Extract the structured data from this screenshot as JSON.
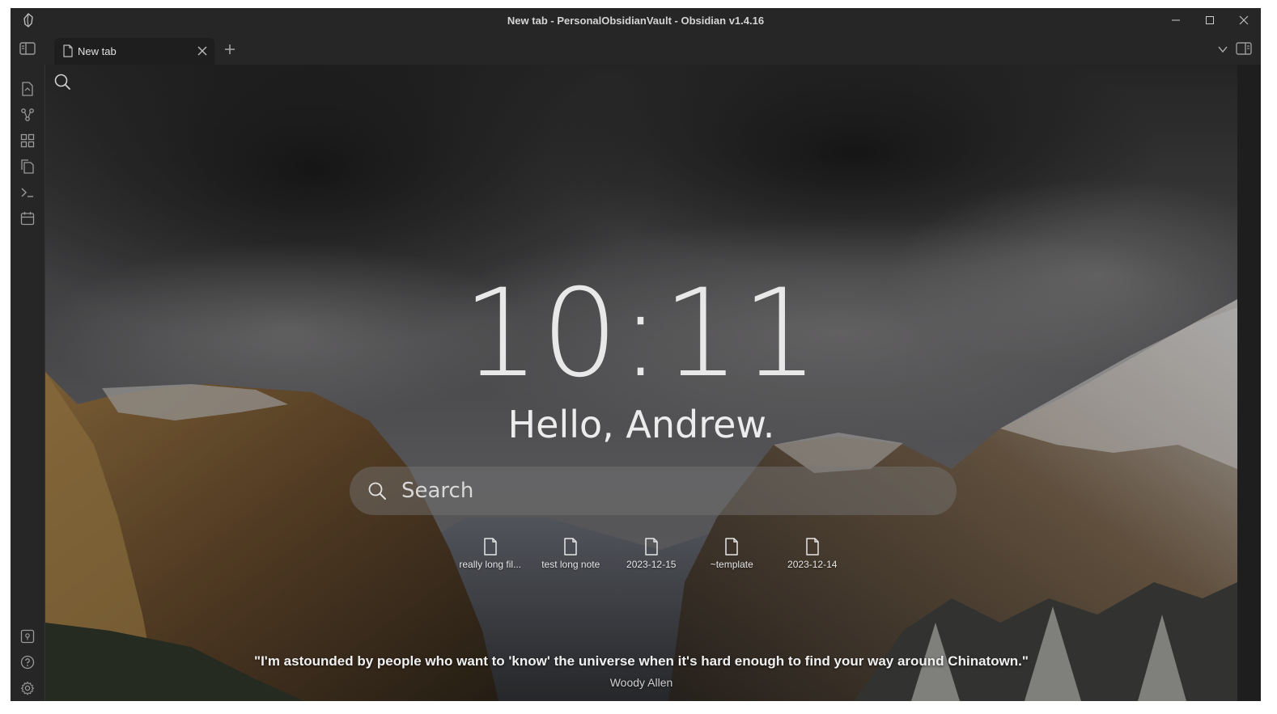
{
  "window": {
    "title": "New tab - PersonalObsidianVault - Obsidian v1.4.16"
  },
  "tabs": [
    {
      "label": "New tab",
      "active": true
    }
  ],
  "ribbon": {
    "top_icons": [
      "open-quick-switcher-icon",
      "graph-view-icon",
      "canvas-icon",
      "templates-icon",
      "command-palette-icon",
      "daily-note-calendar-icon"
    ],
    "bottom_icons": [
      "open-vault-icon",
      "help-icon",
      "settings-icon"
    ]
  },
  "main": {
    "clock": "10:11",
    "greeting": "Hello, Andrew.",
    "search_placeholder": "Search",
    "recent_files": [
      {
        "label": "really long fil..."
      },
      {
        "label": "test long note"
      },
      {
        "label": "2023-12-15"
      },
      {
        "label": "~template"
      },
      {
        "label": "2023-12-14"
      }
    ],
    "quote": "\"I'm astounded by people who want to 'know' the universe when it's hard enough to find your way around Chinatown.\"",
    "quote_author": "Woody Allen"
  },
  "colors": {
    "chrome": "#262626",
    "editor": "#1e1e1e",
    "text": "#dcddde"
  }
}
